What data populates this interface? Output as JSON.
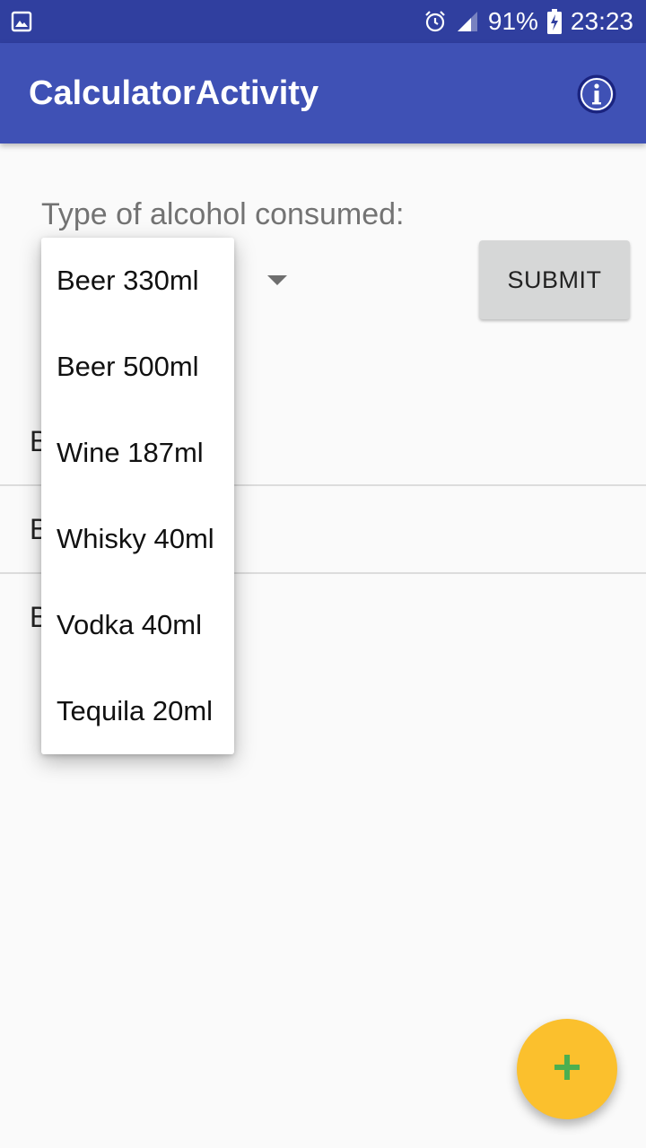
{
  "status_bar": {
    "battery": "91%",
    "time": "23:23",
    "icons": [
      "image-icon",
      "alarm-icon",
      "signal-icon",
      "battery-charging-icon"
    ]
  },
  "app_bar": {
    "title": "CalculatorActivity",
    "info_icon": "info-icon"
  },
  "form": {
    "prompt": "Type of alcohol consumed:",
    "submit_label": "SUBMIT"
  },
  "dropdown": {
    "options": [
      "Beer 330ml",
      "Beer 500ml",
      "Wine 187ml",
      "Whisky 40ml",
      "Vodka 40ml",
      "Tequila 20ml"
    ]
  },
  "list": {
    "items": [
      "B",
      "B",
      "B"
    ]
  },
  "fab": {
    "icon": "plus-icon"
  },
  "colors": {
    "status_bar": "#303f9f",
    "app_bar": "#3f51b5",
    "fab": "#fbc02d",
    "fab_icon": "#4caf50"
  }
}
